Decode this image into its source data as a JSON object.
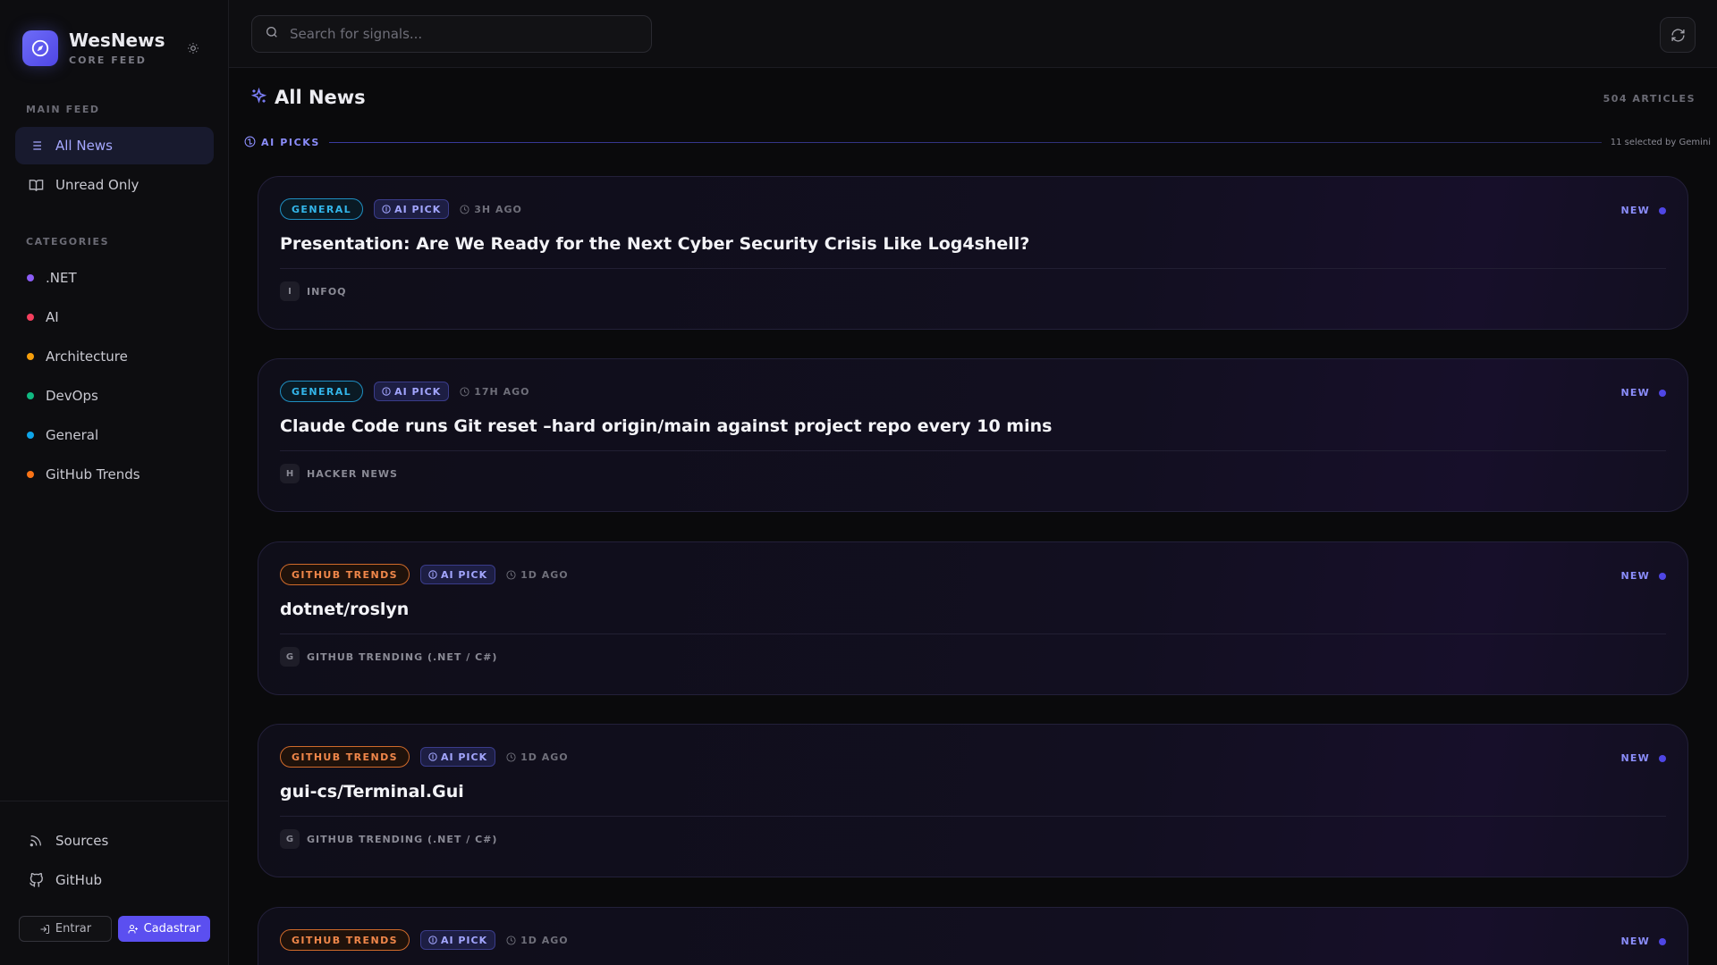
{
  "brand": {
    "name": "WesNews",
    "subtitle": "CORE FEED"
  },
  "sidebar": {
    "main_feed_label": "MAIN FEED",
    "main_items": [
      {
        "label": "All News",
        "icon": "list-icon",
        "active": true
      },
      {
        "label": "Unread Only",
        "icon": "book-open-icon",
        "active": false
      }
    ],
    "categories_label": "CATEGORIES",
    "categories": [
      {
        "label": ".NET",
        "color": "#8b5cf6"
      },
      {
        "label": "AI",
        "color": "#f43f5e"
      },
      {
        "label": "Architecture",
        "color": "#f59e0b"
      },
      {
        "label": "DevOps",
        "color": "#10b981"
      },
      {
        "label": "General",
        "color": "#0ea5e9"
      },
      {
        "label": "GitHub Trends",
        "color": "#f97316"
      }
    ],
    "footer_items": [
      {
        "label": "Sources",
        "icon": "rss-icon"
      },
      {
        "label": "GitHub",
        "icon": "github-icon"
      }
    ],
    "login_label": "Entrar",
    "signup_label": "Cadastrar"
  },
  "search": {
    "placeholder": "Search for signals..."
  },
  "main": {
    "title": "All News",
    "article_count": "504 ARTICLES",
    "ai_section_label": "AI PICKS",
    "ai_section_note": "11 selected by Gemini"
  },
  "articles": [
    {
      "category": "GENERAL",
      "ai_badge": "AI PICK",
      "time": "3H AGO",
      "new_label": "NEW",
      "title": "Presentation: Are We Ready for the Next Cyber Security Crisis Like Log4shell?",
      "source_initial": "I",
      "source": "INFOQ"
    },
    {
      "category": "GENERAL",
      "ai_badge": "AI PICK",
      "time": "17H AGO",
      "new_label": "NEW",
      "title": "Claude Code runs Git reset –hard origin/main against project repo every 10 mins",
      "source_initial": "H",
      "source": "HACKER NEWS"
    },
    {
      "category": "GITHUB TRENDS",
      "ai_badge": "AI PICK",
      "time": "1D AGO",
      "new_label": "NEW",
      "title": "dotnet/roslyn",
      "source_initial": "G",
      "source": "GITHUB TRENDING (.NET / C#)"
    },
    {
      "category": "GITHUB TRENDS",
      "ai_badge": "AI PICK",
      "time": "1D AGO",
      "new_label": "NEW",
      "title": "gui-cs/Terminal.Gui",
      "source_initial": "G",
      "source": "GITHUB TRENDING (.NET / C#)"
    },
    {
      "category": "GITHUB TRENDS",
      "ai_badge": "AI PICK",
      "time": "1D AGO",
      "new_label": "NEW",
      "title": "",
      "source_initial": "",
      "source": ""
    }
  ]
}
